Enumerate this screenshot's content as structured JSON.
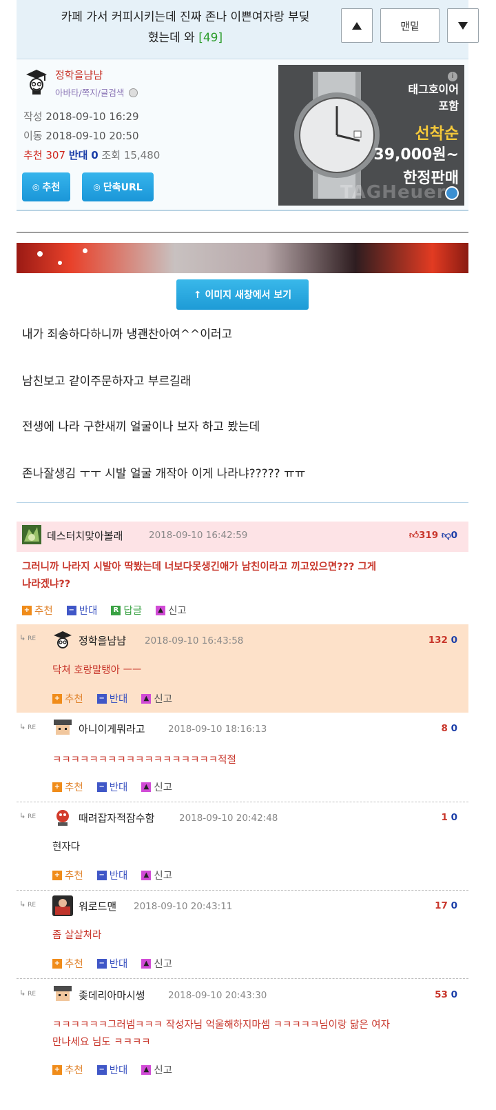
{
  "title": {
    "text_line1": "카페 가서 커피시키는데 진짜 존나 이쁜여자랑 부딪",
    "text_line2": "혔는데 와",
    "comment_count": "[49]",
    "btn_up": "▲",
    "btn_bottom": "맨밑",
    "btn_down": "▼"
  },
  "author": {
    "name": "정학을냠냠",
    "links": "아바타/쪽지/글검색",
    "write_label": "작성",
    "write_date": "2018-09-10 16:29",
    "move_label": "이동",
    "move_date": "2018-09-10 20:50",
    "rec_label": "추천",
    "rec_value": "307",
    "opp_label": "반대",
    "opp_value": "0",
    "views_label": "조회",
    "views_value": "15,480",
    "btn_recommend": "추천",
    "btn_shorturl": "단축URL"
  },
  "ad": {
    "line1": "태그호이어",
    "line2": "포함",
    "line3": "선착순",
    "line4": "39,000원~",
    "line5": "한정판매",
    "brand": "TAGHeuer",
    "info": "i"
  },
  "post": {
    "view_image_button": "↑ 이미지 새창에서 보기",
    "lines": [
      "내가 죄송하다하니까 냉괜찬아여^^이러고",
      "남친보고 같이주문하자고 부르길래",
      "전생에 나라 구한새끼 얼굴이나 보자 하고 봤는데",
      "존나잘생김 ㅜㅜ 시발 얼굴 개작아 이게 나라냐????? ㅠㅠ"
    ]
  },
  "actions": {
    "recommend": "추천",
    "oppose": "반대",
    "reply": "답글",
    "report": "신고",
    "re": "RE"
  },
  "comments": [
    {
      "name": "데스터치맞아볼래",
      "date": "2018-09-10 16:42:59",
      "up": "319",
      "down": "0",
      "text1": "그러니까 나라지 시발아 딱봤는데 너보다못생긴애가 남친이라고 끼고있으면??? 그게",
      "text2": "나라겠냐??"
    }
  ],
  "replies": [
    {
      "name": "정학을냠냠",
      "date": "2018-09-10 16:43:58",
      "up": "132",
      "down": "0",
      "text": "닥쳐 호랑말탱아 ㅡㅡ"
    },
    {
      "name": "아니이게뭐라고",
      "date": "2018-09-10 18:16:13",
      "up": "8",
      "down": "0",
      "text": "ㅋㅋㅋㅋㅋㅋㅋㅋㅋㅋㅋㅋㅋㅋㅋㅋㅋㅋ적절"
    },
    {
      "name": "때려잡자적잠수함",
      "date": "2018-09-10 20:42:48",
      "up": "1",
      "down": "0",
      "text": "현자다"
    },
    {
      "name": "워로드맨",
      "date": "2018-09-10 20:43:11",
      "up": "17",
      "down": "0",
      "text": "좀 살살쳐라"
    },
    {
      "name": "좆데리아마시썽",
      "date": "2018-09-10 20:43:30",
      "up": "53",
      "down": "0",
      "text1": "ㅋㅋㅋㅋㅋㅋ그러넴ㅋㅋㅋ 작성자님 억울해하지마셈 ㅋㅋㅋㅋㅋ님이랑 닮은 여자",
      "text2": "만나세요 님도 ㅋㅋㅋㅋ"
    }
  ],
  "colors": {
    "accent_blue": "#1e9bd6",
    "title_bg": "#e6f1f8",
    "comment_head_bg": "#fde3e6",
    "reply_highlight": "#fde1c9",
    "red_text": "#c8362b"
  }
}
